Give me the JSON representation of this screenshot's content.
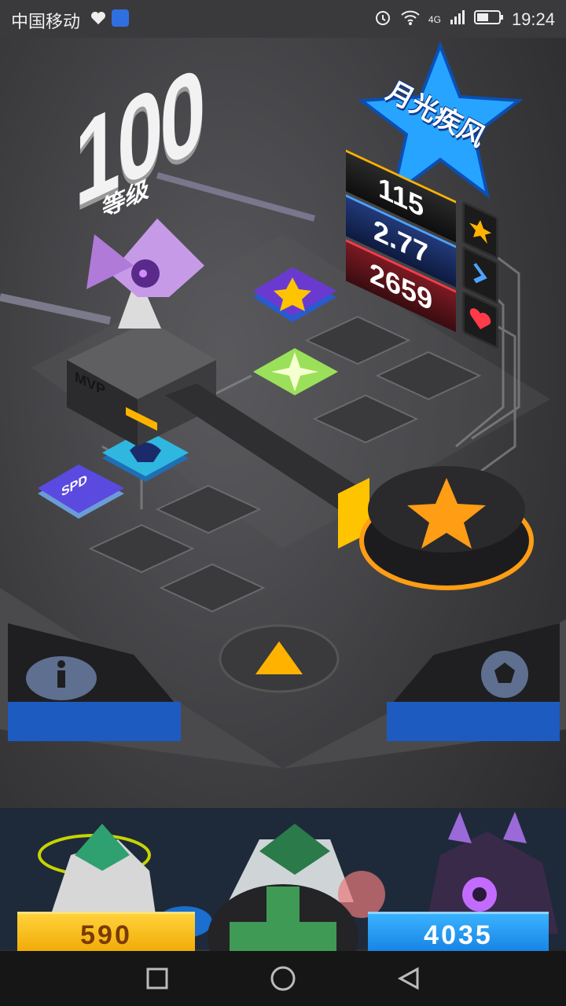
{
  "status_bar": {
    "carrier": "中国移动",
    "network": "4G",
    "time": "19:24"
  },
  "hero": {
    "level": "100",
    "level_label": "等级",
    "name": "月光疾风",
    "stand_label": "MVP"
  },
  "stats": [
    {
      "value": "115",
      "icon": "star-icon",
      "color": "#ffb300"
    },
    {
      "value": "2.77",
      "icon": "speed-chevron-icon",
      "color": "#4da3ff"
    },
    {
      "value": "2659",
      "icon": "heart-icon",
      "color": "#ff3a4a"
    }
  ],
  "tiles": {
    "speed_tile_label": "SPD"
  },
  "currency": {
    "gold": "590",
    "gems": "4035"
  },
  "colors": {
    "accent_orange": "#ff9d14",
    "gold_bar": "#f0a500",
    "blue_bar": "#127de0"
  }
}
